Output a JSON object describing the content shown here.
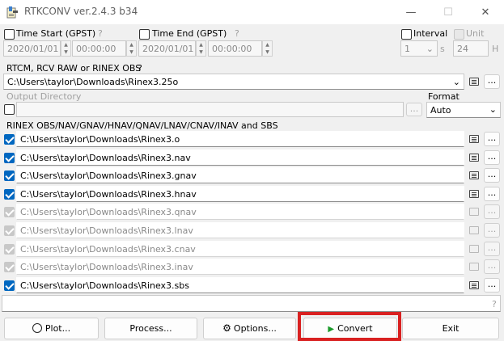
{
  "window": {
    "title": "RTKCONV ver.2.4.3 b34",
    "minimize_glyph": "—",
    "maximize_glyph": "☐",
    "close_glyph": "✕"
  },
  "time": {
    "start_label": "Time Start (GPST)",
    "start_help": "?",
    "start_date": "2020/01/01",
    "start_time": "00:00:00",
    "end_label": "Time End (GPST)",
    "end_help": "?",
    "end_date": "2020/01/01",
    "end_time": "00:00:00",
    "interval_label": "Interval",
    "interval_value": "1",
    "interval_unit": "s",
    "unit_label": "Unit",
    "unit_value": "24",
    "unit_unit": "H"
  },
  "input": {
    "label": "RTCM, RCV RAW or RINEX OBS",
    "help": "?",
    "path": "C:\\Users\\taylor\\Downloads\\Rinex3.25o",
    "browse_label": "..."
  },
  "output": {
    "dir_label": "Output Directory",
    "dir_value": "",
    "browse_label": "...",
    "format_label": "Format",
    "format_value": "Auto"
  },
  "outfiles": {
    "label": "RINEX OBS/NAV/GNAV/HNAV/QNAV/LNAV/CNAV/INAV and SBS",
    "browse_label": "...",
    "items": [
      {
        "path": "C:\\Users\\taylor\\Downloads\\Rinex3.o",
        "checked": true,
        "enabled": true
      },
      {
        "path": "C:\\Users\\taylor\\Downloads\\Rinex3.nav",
        "checked": true,
        "enabled": true
      },
      {
        "path": "C:\\Users\\taylor\\Downloads\\Rinex3.gnav",
        "checked": true,
        "enabled": true
      },
      {
        "path": "C:\\Users\\taylor\\Downloads\\Rinex3.hnav",
        "checked": true,
        "enabled": true
      },
      {
        "path": "C:\\Users\\taylor\\Downloads\\Rinex3.qnav",
        "checked": true,
        "enabled": false
      },
      {
        "path": "C:\\Users\\taylor\\Downloads\\Rinex3.lnav",
        "checked": true,
        "enabled": false
      },
      {
        "path": "C:\\Users\\taylor\\Downloads\\Rinex3.cnav",
        "checked": true,
        "enabled": false
      },
      {
        "path": "C:\\Users\\taylor\\Downloads\\Rinex3.inav",
        "checked": true,
        "enabled": false
      },
      {
        "path": "C:\\Users\\taylor\\Downloads\\Rinex3.sbs",
        "checked": true,
        "enabled": true
      }
    ]
  },
  "status": {
    "message": "",
    "help": "?"
  },
  "buttons": {
    "plot": "Plot...",
    "process": "Process...",
    "options": "Options...",
    "convert": "Convert",
    "exit": "Exit"
  },
  "icons": {
    "app": "rtkconv-app-icon",
    "plot": "plot-icon",
    "options": "gear-icon",
    "convert": "play-icon",
    "file_view": "note-icon"
  },
  "colors": {
    "checkbox": "#0067c0",
    "convert_play": "#1a9a2a",
    "highlight_box": "#d92121"
  }
}
